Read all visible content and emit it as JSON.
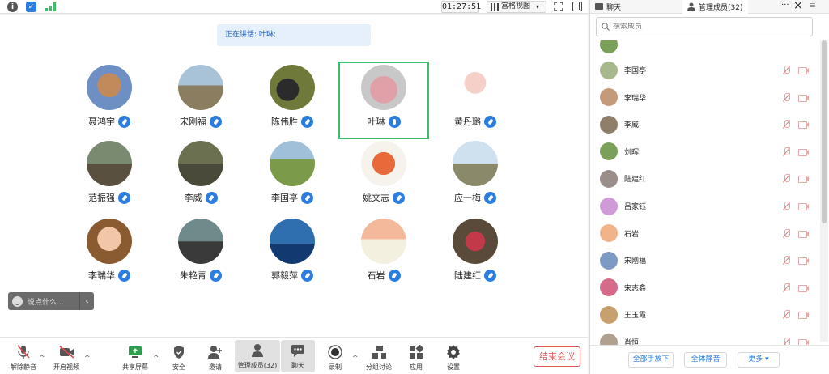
{
  "topbar": {
    "timer": "01:27:51",
    "view_label": "宫格视图",
    "view_caret": "▾"
  },
  "stage": {
    "speaker_text": "正在讲话: 叶琳;",
    "participants": [
      {
        "name": "聂鸿宇",
        "mic": "muted"
      },
      {
        "name": "宋刚福",
        "mic": "muted"
      },
      {
        "name": "陈伟胜",
        "mic": "muted"
      },
      {
        "name": "叶琳",
        "mic": "speaking"
      },
      {
        "name": "黄丹璐",
        "mic": "muted"
      },
      {
        "name": "范振强",
        "mic": "muted"
      },
      {
        "name": "李威",
        "mic": "muted"
      },
      {
        "name": "李国亭",
        "mic": "muted"
      },
      {
        "name": "姚文志",
        "mic": "muted"
      },
      {
        "name": "应一梅",
        "mic": "muted"
      },
      {
        "name": "李瑞华",
        "mic": "muted"
      },
      {
        "name": "朱艳青",
        "mic": "muted"
      },
      {
        "name": "郭毅萍",
        "mic": "muted"
      },
      {
        "name": "石岩",
        "mic": "muted"
      },
      {
        "name": "陆建红",
        "mic": "muted"
      }
    ],
    "chat_placeholder": "说点什么...",
    "chat_arrow": "‹"
  },
  "toolbar": {
    "unmute": "解除静音",
    "start_video": "开启视频",
    "share_screen": "共享屏幕",
    "security": "安全",
    "invite": "邀请",
    "manage_members": "管理成员(32)",
    "chat": "聊天",
    "record": "录制",
    "breakout": "分组讨论",
    "apps": "应用",
    "settings": "设置",
    "end_meeting": "结束会议",
    "caret": "^"
  },
  "panel": {
    "tab_chat": "聊天",
    "tab_members": "管理成员(32)",
    "more": "···",
    "close": "×",
    "menu": "≡",
    "search_placeholder": "搜索成员",
    "members": [
      {
        "name": "李国亭"
      },
      {
        "name": "李瑞华"
      },
      {
        "name": "李威"
      },
      {
        "name": "刘晖"
      },
      {
        "name": "陆建红"
      },
      {
        "name": "吕家钰"
      },
      {
        "name": "石岩"
      },
      {
        "name": "宋刚福"
      },
      {
        "name": "宋志鑫"
      },
      {
        "name": "王玉霞"
      },
      {
        "name": "肖恒"
      }
    ],
    "raise_all_down": "全部手放下",
    "mute_all": "全体静音",
    "more_btn": "更多 ▾"
  },
  "colors": {
    "accent": "#2b7de0",
    "active_border": "#3cbf6a",
    "end_red": "#e25b5b",
    "speaker_bg": "#e6f0fd"
  }
}
